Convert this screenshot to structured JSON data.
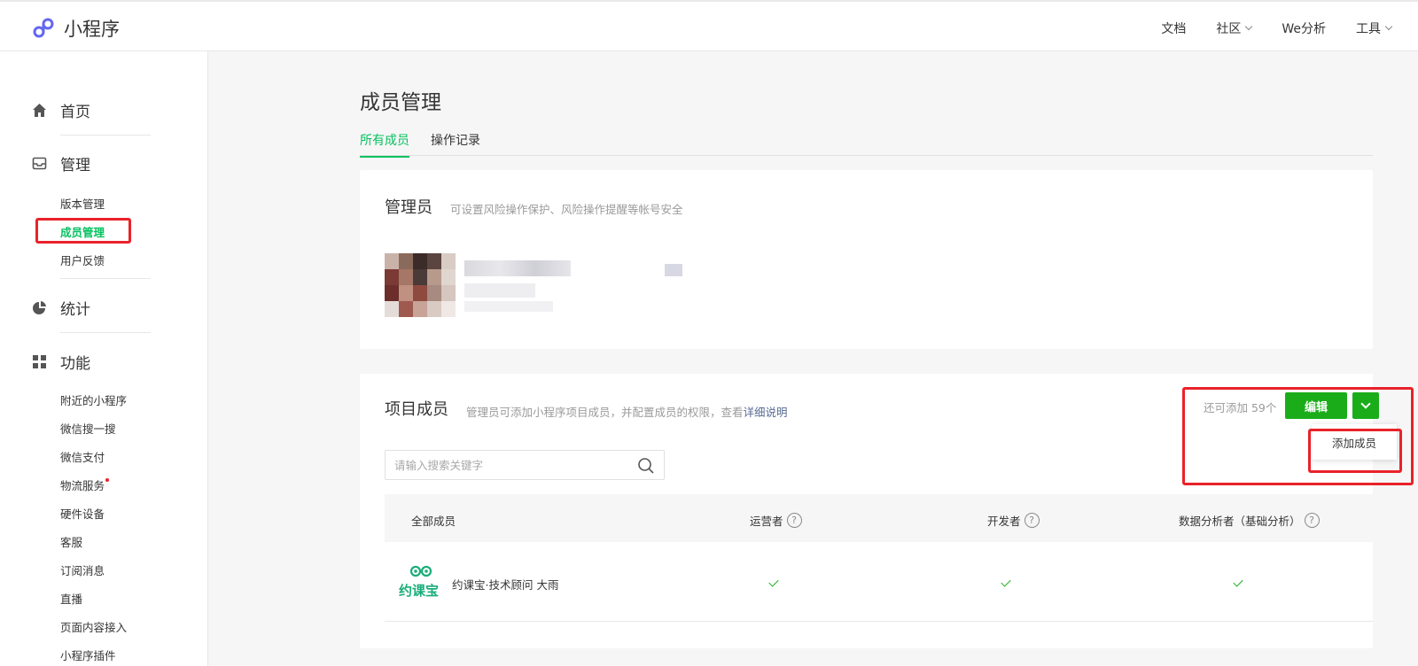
{
  "app": {
    "title": "小程序",
    "brand_color": "#07c160",
    "accent_blue": "#576b95",
    "highlight_red": "#e9222a"
  },
  "topnav": {
    "docs": "文档",
    "community": "社区",
    "analytics": "We分析",
    "tools": "工具"
  },
  "sidebar": {
    "home": "首页",
    "manage": "管理",
    "manage_items": [
      "版本管理",
      "成员管理",
      "用户反馈"
    ],
    "stats": "统计",
    "features": "功能",
    "feature_items": [
      "附近的小程序",
      "微信搜一搜",
      "微信支付",
      "物流服务",
      "硬件设备",
      "客服",
      "订阅消息",
      "直播",
      "页面内容接入",
      "小程序插件"
    ]
  },
  "main": {
    "title": "成员管理",
    "tabs": [
      "所有成员",
      "操作记录"
    ],
    "admin": {
      "title": "管理员",
      "desc": "可设置风险操作保护、风险操作提醒等帐号安全"
    },
    "members": {
      "title": "项目成员",
      "desc": "管理员可添加小程序项目成员，并配置成员的权限，查看",
      "desc_link": "详细说明",
      "quota": "还可添加 59个",
      "edit_button": "编辑",
      "dropdown_item": "添加成员",
      "search_placeholder": "请输入搜索关键字",
      "columns": [
        "全部成员",
        "运营者",
        "开发者",
        "数据分析者（基础分析）"
      ],
      "rows": [
        {
          "logo_text": "约课宝",
          "name": "约课宝·技术顾问 大雨",
          "operator": true,
          "developer": true,
          "analyst": true
        }
      ]
    }
  }
}
